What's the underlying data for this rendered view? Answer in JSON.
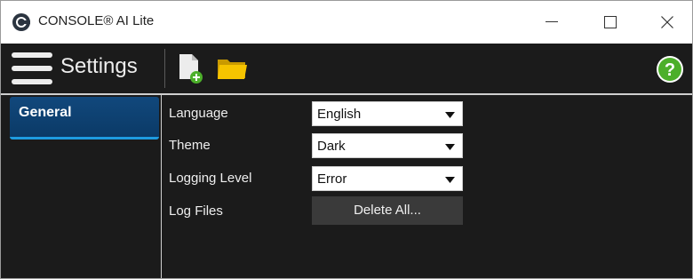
{
  "window": {
    "title": "CONSOLE® AI Lite",
    "icons": {
      "app": "console-app-icon",
      "minimize": "minimize-icon",
      "maximize": "maximize-icon",
      "close": "close-icon"
    }
  },
  "toolbar": {
    "title": "Settings",
    "icons": [
      "hamburger-menu-icon",
      "new-file-icon",
      "open-folder-icon",
      "help-icon"
    ]
  },
  "sidebar": {
    "items": [
      {
        "label": "General",
        "selected": true
      }
    ]
  },
  "settings": {
    "language": {
      "label": "Language",
      "value": "English"
    },
    "theme": {
      "label": "Theme",
      "value": "Dark"
    },
    "logging_level": {
      "label": "Logging Level",
      "value": "Error"
    },
    "log_files": {
      "label": "Log Files",
      "button_label": "Delete All..."
    }
  },
  "colors": {
    "background": "#1b1b1b",
    "selected_nav": "#0b3a67",
    "selected_nav_accent": "#1e9be0",
    "help_icon": "#4caf2a",
    "folder_icon": "#f6c400",
    "button": "#3a3a3a"
  }
}
